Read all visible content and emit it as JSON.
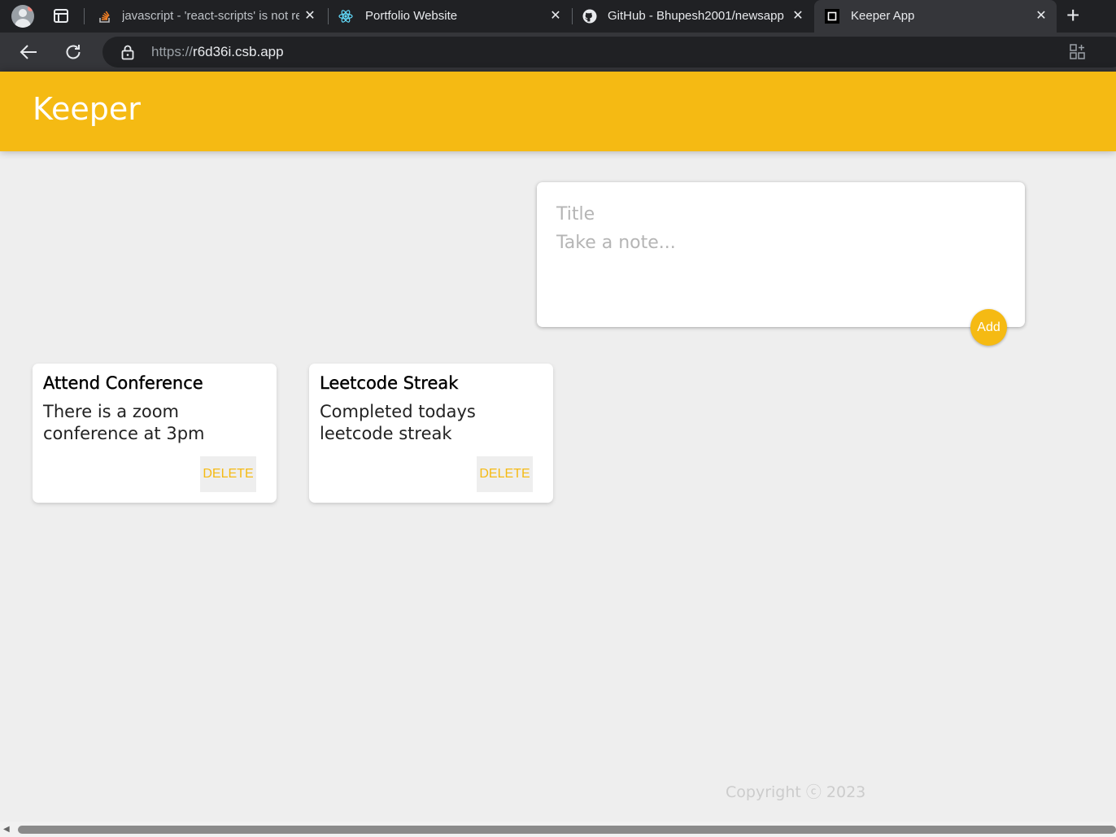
{
  "browser": {
    "tabs": [
      {
        "title": "javascript - 'react-scripts' is not recognized",
        "icon": "stackoverflow-icon"
      },
      {
        "title": "Portfolio Website",
        "icon": "react-icon"
      },
      {
        "title": "GitHub - Bhupesh2001/newsapp",
        "icon": "github-icon"
      },
      {
        "title": "Keeper App",
        "icon": "codesandbox-icon",
        "active": true
      }
    ],
    "new_tab_label": "+",
    "url_protocol": "https://",
    "url_host": "r6d36i.csb.app"
  },
  "app": {
    "title": "Keeper",
    "accent_color": "#f5ba13",
    "create_note": {
      "title_placeholder": "Title",
      "content_placeholder": "Take a note...",
      "add_label": "Add"
    },
    "notes": [
      {
        "title": "Attend Conference",
        "content": "There is a zoom conference at 3pm",
        "delete_label": "DELETE"
      },
      {
        "title": "Leetcode Streak",
        "content": "Completed todays leetcode streak",
        "delete_label": "DELETE"
      }
    ],
    "footer": "Copyright ⓒ 2023"
  }
}
